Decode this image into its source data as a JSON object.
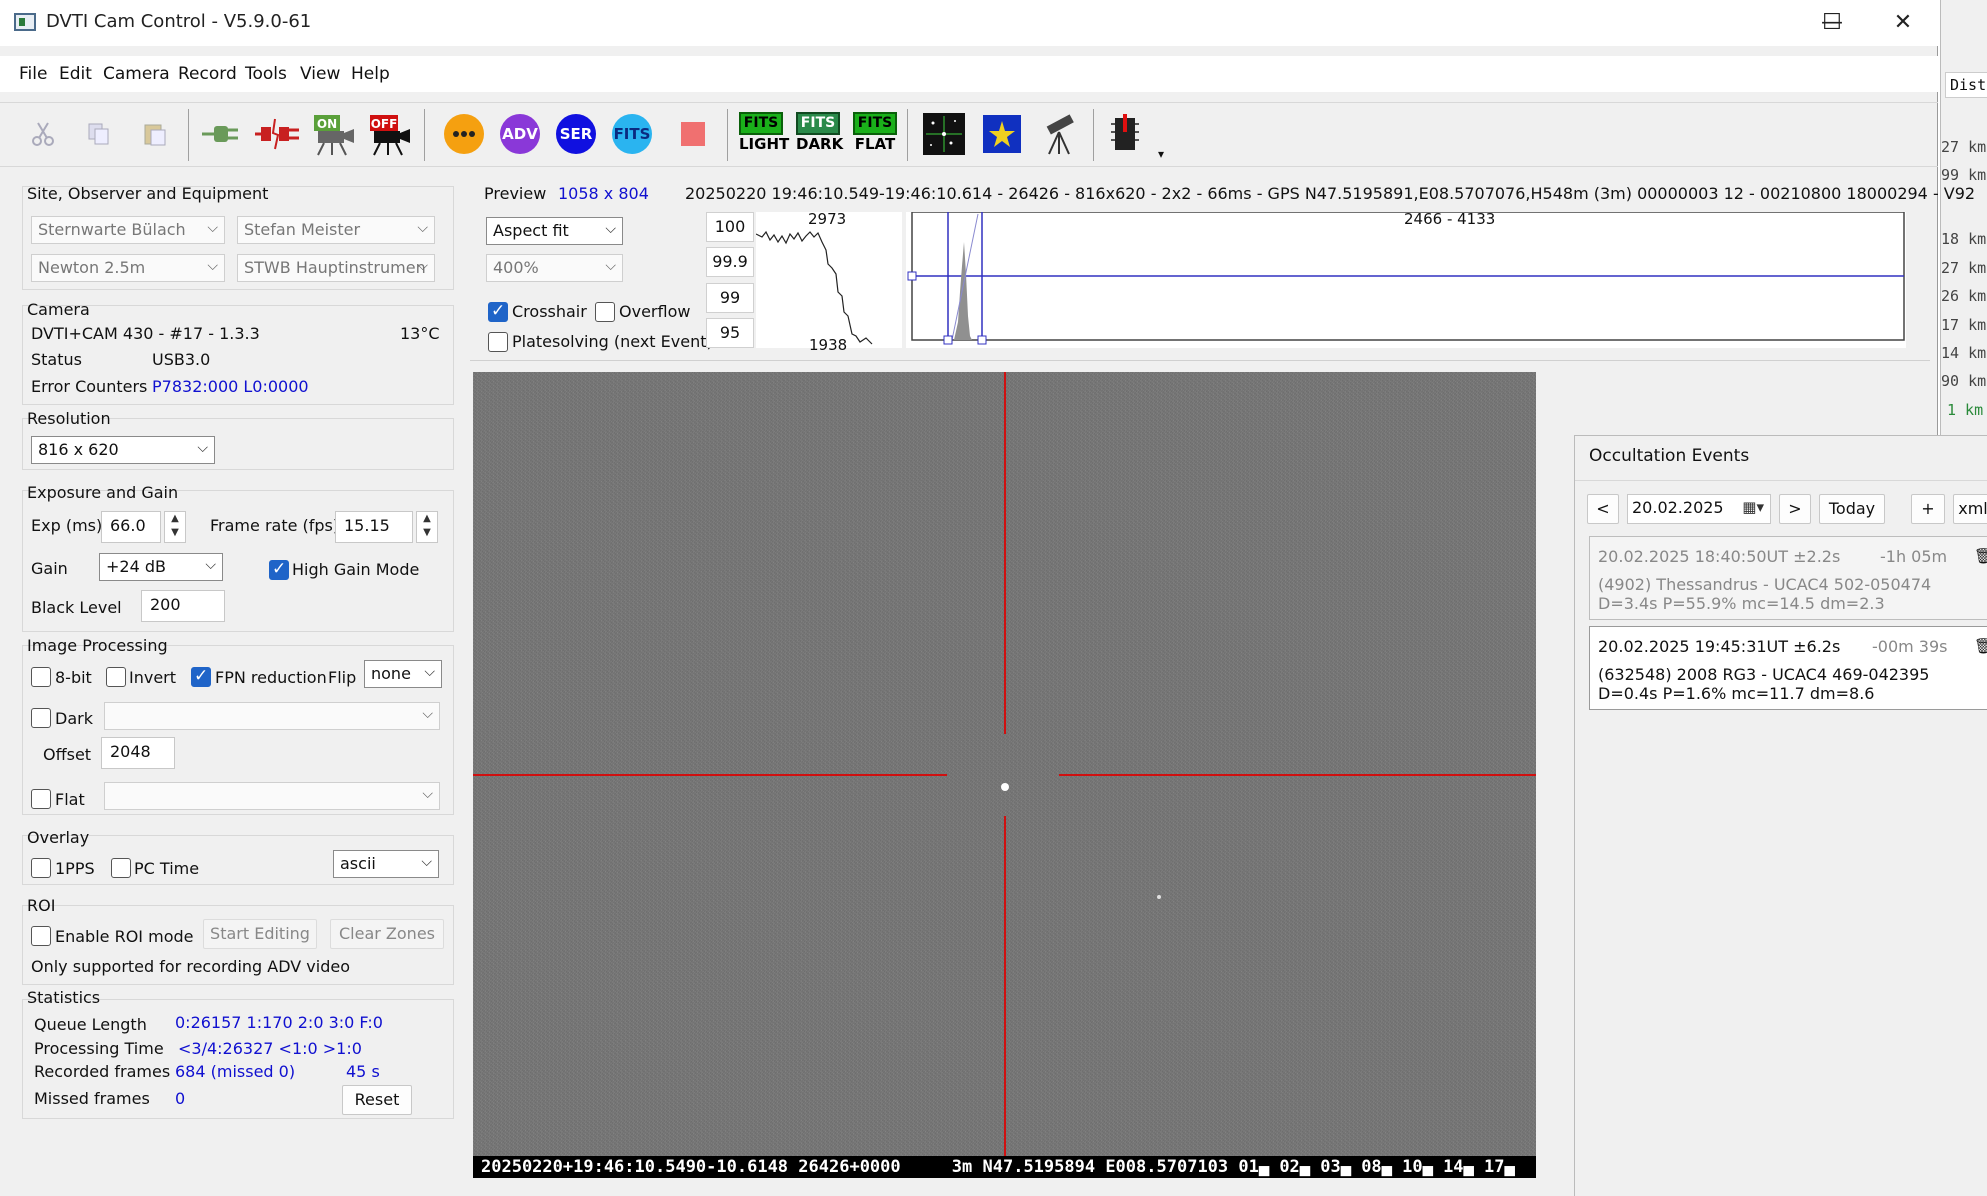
{
  "window": {
    "title": "DVTI Cam Control - V5.9.0-61",
    "minimize": "—",
    "maximize": "☐",
    "close": "✕"
  },
  "menu": [
    "File",
    "Edit",
    "Camera",
    "Record",
    "Tools",
    "View",
    "Help"
  ],
  "toolbar": {
    "adv": "ADV",
    "ser": "SER",
    "fits": "FITS",
    "fits_light": "LIGHT",
    "fits_dark": "DARK",
    "fits_flat": "FLAT",
    "on": "ON",
    "off": "OFF",
    "more": "▾"
  },
  "site": {
    "title": "Site, Observer and Equipment",
    "observatory": "Sternwarte Bülach",
    "observer": "Stefan Meister",
    "telescope": "Newton 2.5m",
    "instrument": "STWB Hauptinstrumen"
  },
  "camera": {
    "title": "Camera",
    "model": "DVTI+CAM 430  -  #17  -  1.3.3",
    "temperature": "13°C",
    "status_label": "Status",
    "status_value": "USB3.0",
    "errors_label": "Error Counters",
    "errors_value": "P7832:000 L0:0000"
  },
  "resolution": {
    "title": "Resolution",
    "value": "816 x 620"
  },
  "exposure": {
    "title": "Exposure and Gain",
    "exp_label": "Exp (ms)",
    "exp_value": "66.0",
    "fps_label": "Frame rate (fps)",
    "fps_value": "15.15",
    "gain_label": "Gain",
    "gain_value": "+24 dB",
    "high_gain_label": "High Gain Mode",
    "high_gain": true,
    "black_label": "Black Level",
    "black_value": "200"
  },
  "processing": {
    "title": "Image Processing",
    "bit8": "8-bit",
    "invert": "Invert",
    "fpn": "FPN reduction",
    "flip_label": "Flip",
    "flip_value": "none",
    "dark": "Dark",
    "offset_label": "Offset",
    "offset_value": "2048",
    "flat": "Flat"
  },
  "overlay": {
    "title": "Overlay",
    "pps": "1PPS",
    "pctime": "PC Time",
    "mode": "ascii"
  },
  "roi": {
    "title": "ROI",
    "enable": "Enable ROI mode",
    "start": "Start Editing",
    "clear": "Clear Zones",
    "note": "Only supported for recording ADV video"
  },
  "stats": {
    "title": "Statistics",
    "queue_label": "Queue Length",
    "queue_value": "0:26157  1:170  2:0  3:0  F:0",
    "proc_label": "Processing Time",
    "proc_value": "<3/4:26327 <1:0  >1:0",
    "rec_label": "Recorded frames",
    "rec_value": "684 (missed 0)",
    "rec_time": "45 s",
    "missed_label": "Missed frames",
    "missed_value": "0",
    "reset": "Reset"
  },
  "preview": {
    "label": "Preview",
    "size": "1058 x 804",
    "info": "20250220 19:46:10.549-19:46:10.614 - 26426 - 816x620 - 2x2 - 66ms - GPS N47.5195891,E08.5707076,H548m (3m) 00000003 12 - 00210800 18000294 - V92",
    "fit": "Aspect fit",
    "zoom": "400%",
    "crosshair": "Crosshair",
    "overflow": "Overflow",
    "platesolve": "Platesolving (next Event)",
    "levels": [
      "100",
      "99.9",
      "99",
      "95"
    ],
    "curve_max": "2973",
    "curve_min": "1938",
    "hist_range": "2466 - 4133"
  },
  "image_overlay": "20250220+19:46:10.5490-10.6148 26426+0000     3m N47.5195894 E008.5707103 01▄ 02▄ 03▄ 08▄ 10▄ 14▄ 17▄",
  "occultation": {
    "title": "Occultation Events",
    "prev": "<",
    "date": "20.02.2025",
    "next": ">",
    "today": "Today",
    "add": "+",
    "xml": "xml",
    "events": [
      {
        "time": "20.02.2025 18:40:50UT ±2.2s",
        "rel": "-1h 05m",
        "object": "(4902) Thessandrus - UCAC4 502-050474",
        "details": "D=3.4s   P=55.9%   mc=14.5   dm=2.3"
      },
      {
        "time": "20.02.2025 19:45:31UT ±6.2s",
        "rel": "-00m 39s",
        "object": "(632548) 2008 RG3 - UCAC4 469-042395",
        "details": "D=0.4s   P=1.6%   mc=11.7   dm=8.6"
      }
    ]
  },
  "bg_window": {
    "header": "Dist",
    "rows": [
      "27 km",
      "99 km",
      "18 km",
      "27 km",
      "26 km",
      "17 km",
      "14 km",
      "90 km",
      "1 km"
    ]
  },
  "colors": {
    "crosshair": "#d01010",
    "link_blue": "#1010d0",
    "check_blue": "#1f64c8"
  }
}
